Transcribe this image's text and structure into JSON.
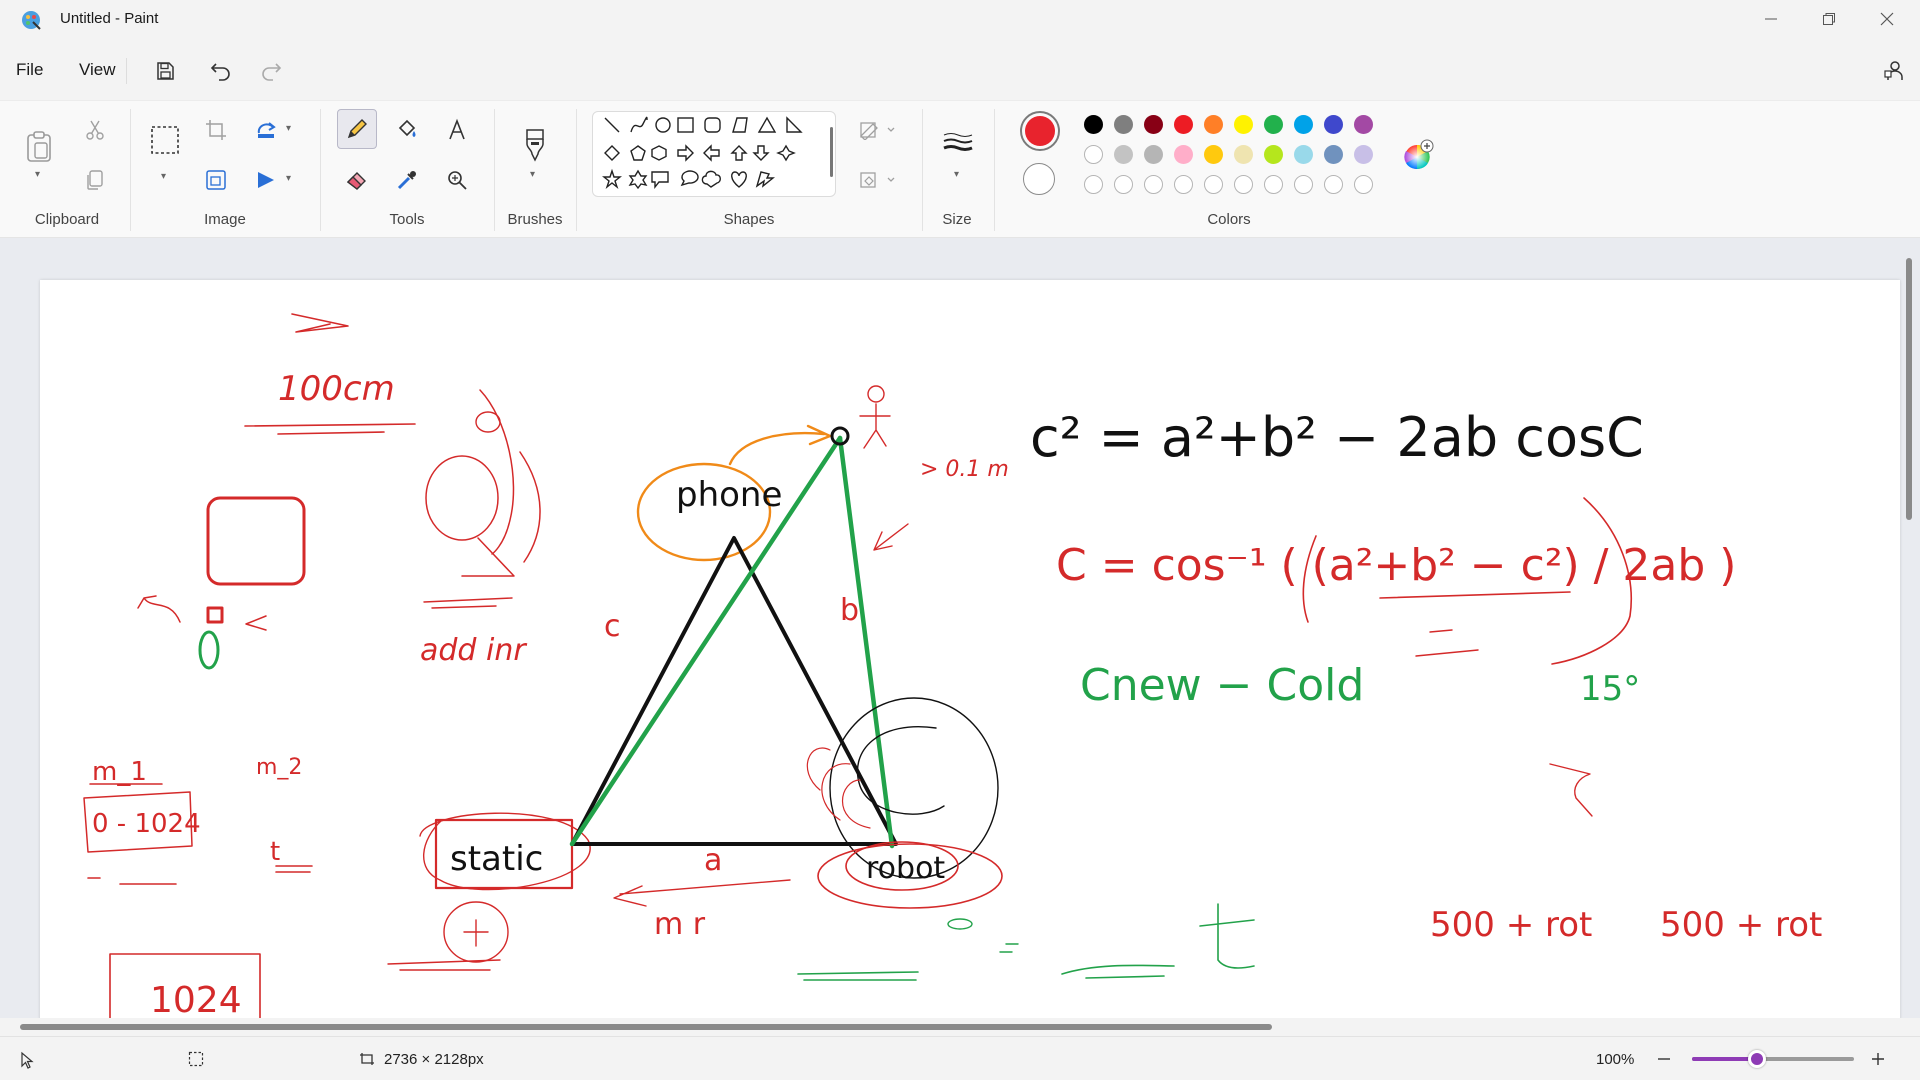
{
  "window": {
    "title": "Untitled - Paint",
    "minimize_icon": "minimize-icon",
    "maximize_icon": "restore-icon",
    "close_icon": "close-icon"
  },
  "menu": {
    "file": "File",
    "view": "View",
    "quick_actions": [
      "save-icon",
      "undo-icon",
      "redo-icon"
    ],
    "account_icon": "account-icon"
  },
  "ribbon": {
    "groups": {
      "clipboard": "Clipboard",
      "image": "Image",
      "tools": "Tools",
      "brushes": "Brushes",
      "shapes": "Shapes",
      "size": "Size",
      "colors": "Colors"
    },
    "active_tool": "pencil",
    "primary_color": "#e8232d",
    "secondary_color": "#ffffff",
    "palette_row1": [
      "#000000",
      "#7f7f7f",
      "#880015",
      "#ed1c24",
      "#ff7f27",
      "#fff200",
      "#22b14c",
      "#00a2e8",
      "#3f48cc",
      "#a349a4"
    ],
    "palette_row2": [
      "#ffffff",
      "#c3c3c3",
      "#b5b5b5",
      "#ffaec9",
      "#ffc90e",
      "#efe4b0",
      "#b5e61d",
      "#99d9ea",
      "#7092be",
      "#c8bfe7"
    ]
  },
  "canvas": {
    "labels": {
      "distance": "100cm",
      "phone": "phone",
      "static": "static",
      "robot": "robot",
      "side_a": "a",
      "side_b": "b",
      "side_c": "c",
      "law_of_cosines": "c² = a²+b² − 2ab cosC",
      "inverse": "C = cos⁻¹ ( (a²+b² − c²) / 2ab )",
      "difference": "Cnew − Cold",
      "angle": "15°",
      "counter1": "0 - 1024",
      "box_1024": "1024",
      "m1": "m_1",
      "m2": "m_2",
      "add_inr": "add inr",
      "gt_01m": "> 0.1 m",
      "t_rot1": "500 + rot",
      "t_rot2": "500 + rot",
      "mr": "m r",
      "t_char": "t"
    }
  },
  "status": {
    "pointer_icon": "cursor-icon",
    "selection_icon": "selection-icon",
    "canvas_size": "2736 × 2128px",
    "zoom": "100%",
    "zoom_level": 0.4,
    "zoom_out_icon": "minus-icon",
    "zoom_in_icon": "plus-icon"
  }
}
